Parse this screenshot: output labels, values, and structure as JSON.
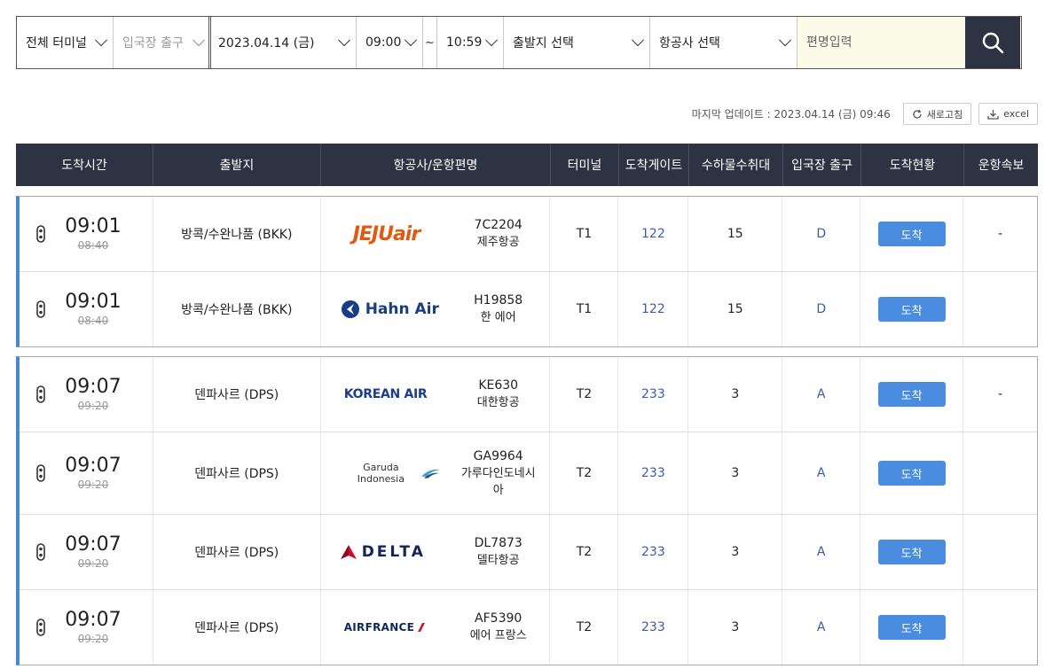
{
  "filters": {
    "terminal": "전체 터미널",
    "exit_gate": "입국장 출구",
    "date": "2023.04.14 (금)",
    "time_from": "09:00",
    "tilde": "~",
    "time_to": "10:59",
    "origin": "출발지 선택",
    "airline": "항공사 선택",
    "flight_placeholder": "편명입력"
  },
  "update": {
    "text": "마지막 업데이트 : 2023.04.14 (금) 09:46",
    "refresh_label": "새로고침",
    "excel_label": "excel"
  },
  "columns": [
    "도착시간",
    "출발지",
    "항공사/운항편명",
    "터미널",
    "도착게이트",
    "수하물수취대",
    "입국장 출구",
    "도착현황",
    "운항속보"
  ],
  "groups": [
    {
      "rows": [
        {
          "time": "09:01",
          "scheduled": "08:40",
          "origin": "방콕/수완나품 (BKK)",
          "logo": "jejuair-logo",
          "logo_text": "JEJUair",
          "flight": "7C2204",
          "airline_name": "제주항공",
          "terminal": "T1",
          "gate": "122",
          "baggage": "15",
          "exit": "D",
          "status": "도착",
          "notice": "-"
        },
        {
          "time": "09:01",
          "scheduled": "08:40",
          "origin": "방콕/수완나품 (BKK)",
          "logo": "hahnair-logo",
          "logo_text": "Hahn Air",
          "flight": "H19858",
          "airline_name": "한 에어",
          "terminal": "T1",
          "gate": "122",
          "baggage": "15",
          "exit": "D",
          "status": "도착",
          "notice": ""
        }
      ]
    },
    {
      "rows": [
        {
          "time": "09:07",
          "scheduled": "09:20",
          "origin": "덴파사르 (DPS)",
          "logo": "koreanair-logo",
          "logo_text": "KOREAN AIR",
          "flight": "KE630",
          "airline_name": "대한항공",
          "terminal": "T2",
          "gate": "233",
          "baggage": "3",
          "exit": "A",
          "status": "도착",
          "notice": "-"
        },
        {
          "time": "09:07",
          "scheduled": "09:20",
          "origin": "덴파사르 (DPS)",
          "logo": "garuda-logo",
          "logo_text": "Garuda Indonesia",
          "flight": "GA9964",
          "airline_name": "가루다인도네시아",
          "terminal": "T2",
          "gate": "233",
          "baggage": "3",
          "exit": "A",
          "status": "도착",
          "notice": ""
        },
        {
          "time": "09:07",
          "scheduled": "09:20",
          "origin": "덴파사르 (DPS)",
          "logo": "delta-logo",
          "logo_text": "DELTA",
          "flight": "DL7873",
          "airline_name": "델타항공",
          "terminal": "T2",
          "gate": "233",
          "baggage": "3",
          "exit": "A",
          "status": "도착",
          "notice": ""
        },
        {
          "time": "09:07",
          "scheduled": "09:20",
          "origin": "덴파사르 (DPS)",
          "logo": "airfrance-logo",
          "logo_text": "AIRFRANCE",
          "flight": "AF5390",
          "airline_name": "에어 프랑스",
          "terminal": "T2",
          "gate": "233",
          "baggage": "3",
          "exit": "A",
          "status": "도착",
          "notice": ""
        }
      ]
    }
  ],
  "colors": {
    "header_bg": "#2e3344",
    "status_button": "#4a8de0",
    "group_accent": "#4a86d8",
    "link_blue": "#3b5ba8"
  }
}
